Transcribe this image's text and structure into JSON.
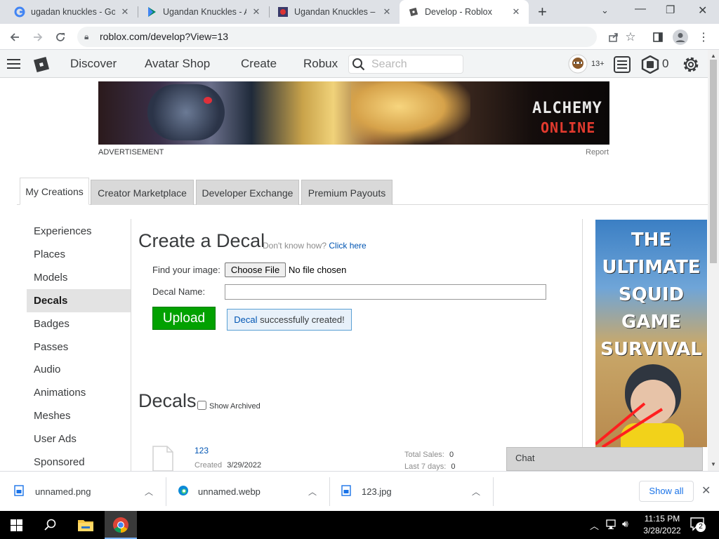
{
  "browser": {
    "tabs": [
      {
        "title": "ugadan knuckles - Goo",
        "active": false
      },
      {
        "title": "Ugandan Knuckles - Ap",
        "active": false
      },
      {
        "title": "Ugandan Knuckles – Fo",
        "active": false
      },
      {
        "title": "Develop - Roblox",
        "active": true
      }
    ],
    "new_tab_label": "+",
    "url": "roblox.com/develop?View=13"
  },
  "roblox_header": {
    "nav": [
      "Discover",
      "Avatar Shop",
      "Create",
      "Robux"
    ],
    "search_placeholder": "Search",
    "age_badge": "13+",
    "robux_count": "0"
  },
  "ad": {
    "advertisement_label": "ADVERTISEMENT",
    "report_label": "Report",
    "banner_text_line1": "ALCHEMY",
    "banner_text_line2": "ONLINE",
    "side_ad_text": "THE ULTIMATE SQUID GAME SURVIVAL"
  },
  "develop_tabs": [
    "My Creations",
    "Creator Marketplace",
    "Developer Exchange",
    "Premium Payouts"
  ],
  "sidebar": {
    "items": [
      "Experiences",
      "Places",
      "Models",
      "Decals",
      "Badges",
      "Passes",
      "Audio",
      "Animations",
      "Meshes",
      "User Ads",
      "Sponsored"
    ],
    "active": "Decals"
  },
  "create_decal": {
    "title": "Create a Decal",
    "help_prefix": "Don't know how?",
    "help_link": "Click here",
    "find_image_label": "Find your image:",
    "choose_file_button": "Choose File",
    "no_file_text": "No file chosen",
    "decal_name_label": "Decal Name:",
    "decal_name_value": "",
    "upload_button": "Upload",
    "success_link": "Decal",
    "success_text": "successfully created!"
  },
  "decals": {
    "title": "Decals",
    "show_archived_label": "Show Archived",
    "items": [
      {
        "name": "123",
        "created_label": "Created",
        "created_date": "3/29/2022",
        "total_sales_label": "Total Sales:",
        "total_sales": "0",
        "last7_label": "Last 7 days:",
        "last7": "0"
      }
    ]
  },
  "chat": {
    "label": "Chat"
  },
  "downloads": {
    "items": [
      "unnamed.png",
      "unnamed.webp",
      "123.jpg"
    ],
    "show_all": "Show all"
  },
  "taskbar": {
    "time": "11:15 PM",
    "date": "3/28/2022",
    "notification_count": "2"
  },
  "colors": {
    "upload_green": "#02a101",
    "link_blue": "#0055b3",
    "success_border": "#5aa0d4",
    "success_bg": "#e8f1fa"
  }
}
